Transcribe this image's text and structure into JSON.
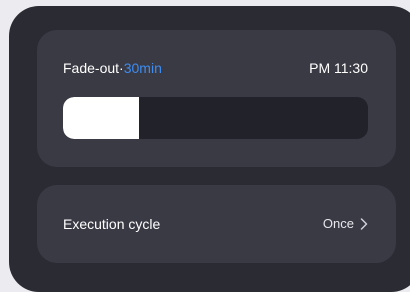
{
  "fade_out": {
    "label": "Fade-out",
    "separator": "·",
    "duration": "30min",
    "time": "PM 11:30",
    "progress_fraction": 0.25
  },
  "execution_cycle": {
    "label": "Execution cycle",
    "value": "Once",
    "chevron_icon": "chevron-right-icon"
  },
  "colors": {
    "accent": "#3d8cf0",
    "panel_bg": "#2b2b34",
    "card_bg": "#3a3a45",
    "track_bg": "#22222b",
    "fill": "#ffffff"
  }
}
